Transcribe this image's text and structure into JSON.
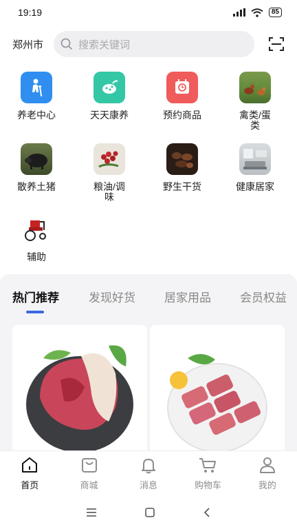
{
  "status_bar": {
    "time": "19:19",
    "battery": "85"
  },
  "header": {
    "city": "郑州市",
    "search_placeholder": "搜索关键词"
  },
  "categories": [
    {
      "label": "养老中心",
      "icon": "elder-care-icon"
    },
    {
      "label": "天天康养",
      "icon": "vegetables-icon"
    },
    {
      "label": "预约商品",
      "icon": "appointment-clock-icon"
    },
    {
      "label": "禽类/蛋类",
      "icon": "poultry-photo"
    },
    {
      "label": "散养土猪",
      "icon": "pig-photo"
    },
    {
      "label": "粮油/调味",
      "icon": "grain-oil-photo"
    },
    {
      "label": "野生干货",
      "icon": "dried-goods-photo"
    },
    {
      "label": "健康居家",
      "icon": "home-interior-photo"
    },
    {
      "label": "辅助",
      "icon": "wheelchair-photo"
    }
  ],
  "tabs": [
    {
      "label": "热门推荐",
      "active": true
    },
    {
      "label": "发现好货",
      "active": false
    },
    {
      "label": "居家用品",
      "active": false
    },
    {
      "label": "会员权益",
      "active": false
    }
  ],
  "products": [
    {
      "image": "pork-leg-photo"
    },
    {
      "image": "pork-ribs-photo"
    }
  ],
  "bottom_nav": [
    {
      "label": "首页",
      "icon": "home-icon",
      "active": true
    },
    {
      "label": "商城",
      "icon": "shopping-bag-icon",
      "active": false
    },
    {
      "label": "消息",
      "icon": "bell-icon",
      "active": false
    },
    {
      "label": "购物车",
      "icon": "cart-icon",
      "active": false
    },
    {
      "label": "我的",
      "icon": "user-icon",
      "active": false
    }
  ],
  "colors": {
    "accent": "#3c67e0",
    "panel_bg": "#f4f4f6",
    "search_bg": "#efeff1"
  }
}
